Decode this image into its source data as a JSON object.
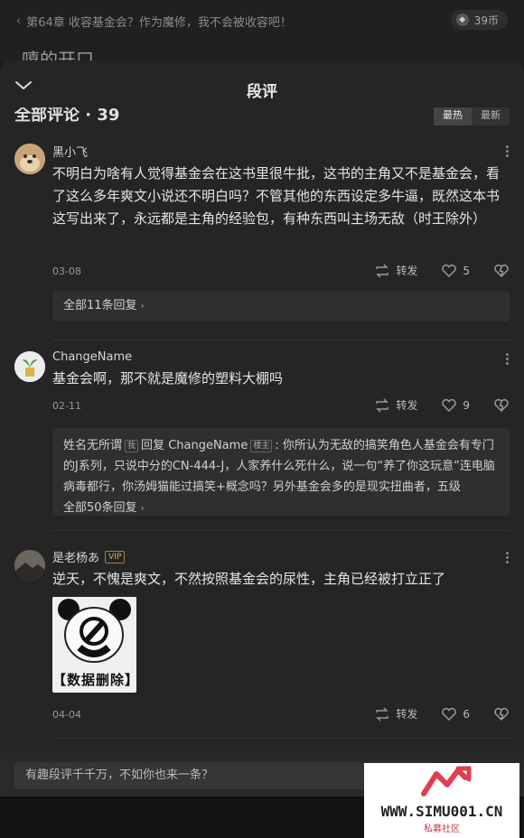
{
  "background": {
    "chapter_title": "第64章 收容基金会？作为魔修，我不会被收容吧！",
    "coins": "39币",
    "coin_icon_glyph": "◆",
    "partial_title": "嘻的开口"
  },
  "sheet": {
    "title": "段评",
    "all_label": "全部评论 · 39",
    "sort_tabs": [
      "最热",
      "最新"
    ]
  },
  "comments": [
    {
      "user": "黑小飞",
      "text": "不明白为啥有人觉得基金会在这书里很牛批，这书的主角又不是基金会，看了这么多年爽文小说还不明白吗？不管其他的东西设定多牛逼，既然这本书这写出来了，永远都是主角的经验包，有种东西叫主场无敌（时王除外）",
      "date": "03-08",
      "share": "转发",
      "likes": "5",
      "replies_link": "全部11条回复"
    },
    {
      "user": "ChangeName",
      "text": "基金会啊，那不就是魔修的塑料大棚吗",
      "date": "02-11",
      "share": "转发",
      "likes": "9",
      "reply": {
        "author": "姓名无所谓",
        "author_tag": "我",
        "verb": "回复",
        "target": "ChangeName",
        "target_tag": "楼主",
        "text": ": 你所认为无敌的搞笑角色人基金会有专门的J系列，只说中分的CN-444-J，人家养什么死什么，说一句“养了你这玩意”连电脑病毒都行，你汤姆猫能过搞笑+概念吗？另外基金会多的是现实扭曲者，五级"
      },
      "replies_link": "全部50条回复"
    },
    {
      "user": "是老杨あ",
      "vip": "VIP",
      "text": "逆天，不愧是爽文，不然按照基金会的尿性，主角已经被打立正了",
      "image_caption": "【数据删除】",
      "date": "04-04",
      "share": "转发",
      "likes": "6"
    }
  ],
  "footer": {
    "placeholder": "有趣段评千千万，不如你也来一条？"
  },
  "watermark": {
    "url": "WWW.SIMU001.CN",
    "sub": "私募社区"
  }
}
